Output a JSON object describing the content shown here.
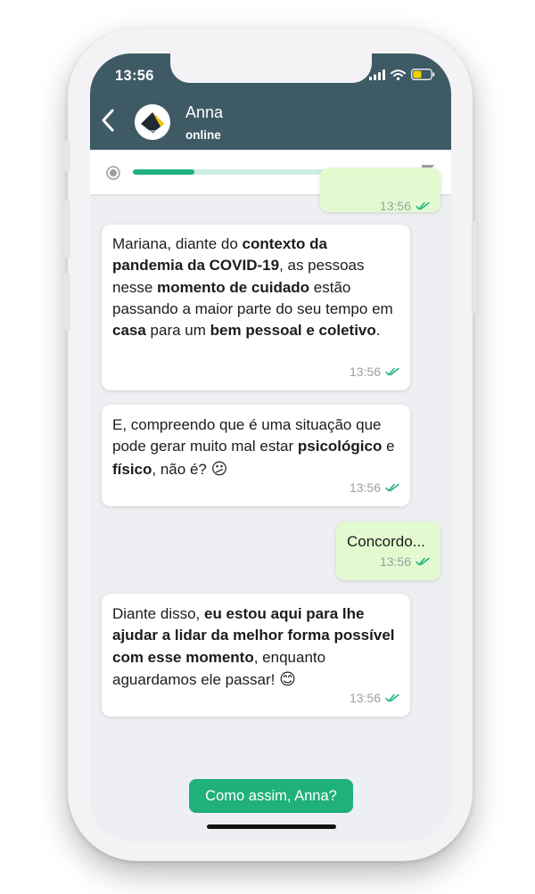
{
  "status_bar": {
    "time": "13:56"
  },
  "header": {
    "contact_name": "Anna",
    "presence": "online"
  },
  "progress": {
    "value_fraction": 0.22
  },
  "messages": [
    {
      "direction": "sent",
      "partially_hidden": true,
      "time": "13:56"
    },
    {
      "direction": "received",
      "segments": [
        {
          "text": "Mariana, diante do ",
          "bold": false
        },
        {
          "text": "contexto da pandemia da COVID-19",
          "bold": true
        },
        {
          "text": ", as pessoas nesse ",
          "bold": false
        },
        {
          "text": "momento de cuidado",
          "bold": true
        },
        {
          "text": " estão passando a maior parte do seu tempo em ",
          "bold": false
        },
        {
          "text": "casa",
          "bold": true
        },
        {
          "text": " para um ",
          "bold": false
        },
        {
          "text": "bem pessoal e coletivo",
          "bold": true
        },
        {
          "text": ".",
          "bold": false
        }
      ],
      "time": "13:56"
    },
    {
      "direction": "received",
      "segments": [
        {
          "text": "E, compreendo que é uma situação que pode gerar muito mal estar ",
          "bold": false
        },
        {
          "text": "psicológico",
          "bold": true
        },
        {
          "text": " e ",
          "bold": false
        },
        {
          "text": "físico",
          "bold": true
        },
        {
          "text": ", não é? ",
          "bold": false
        }
      ],
      "emoji": "😕",
      "time": "13:56"
    },
    {
      "direction": "sent",
      "text": "Concordo...",
      "time": "13:56"
    },
    {
      "direction": "received",
      "segments": [
        {
          "text": "Diante disso, ",
          "bold": false
        },
        {
          "text": "eu estou aqui para lhe ajudar a lidar da melhor forma possível com esse momento",
          "bold": true
        },
        {
          "text": ", enquanto aguardamos ele passar! ",
          "bold": false
        }
      ],
      "emoji": "😊",
      "time": "13:56"
    }
  ],
  "quick_reply": {
    "label": "Como assim, Anna?"
  },
  "icons": {
    "back": "chevron-left-icon",
    "signal": "signal-bars-icon",
    "wifi": "wifi-icon",
    "battery": "battery-icon",
    "progress_start": "radio-icon",
    "progress_end": "flag-icon",
    "read_receipt": "double-check-icon"
  },
  "colors": {
    "header": "#3e5a65",
    "accent_green": "#1fb07b",
    "sent_bubble": "#e3fad0",
    "received_bubble": "#ffffff",
    "battery": "#f5d000"
  }
}
